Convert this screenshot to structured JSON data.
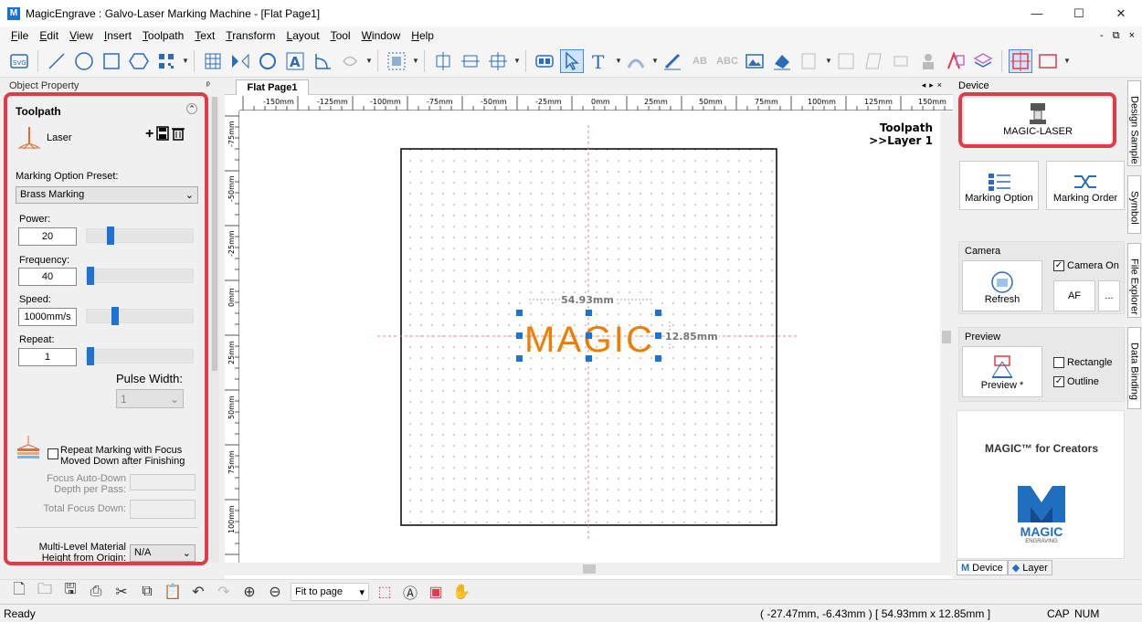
{
  "window": {
    "title": "MagicEngrave : Galvo-Laser Marking Machine - [Flat  Page1]",
    "logo": "M",
    "minimize": "—",
    "maximize": "☐",
    "close": "✕"
  },
  "menu": [
    "File",
    "Edit",
    "View",
    "Insert",
    "Toolpath",
    "Text",
    "Transform",
    "Layout",
    "Tool",
    "Window",
    "Help"
  ],
  "mdi": {
    "min": "-",
    "restore": "⧉",
    "close": "×"
  },
  "toolbar_icons": [
    "svg-icon",
    "line-icon",
    "circle-icon",
    "rect-icon",
    "polygon-icon",
    "qrcode-icon",
    "grid-icon",
    "mirror-icon",
    "rotate-icon",
    "text-a-icon",
    "arc-icon",
    "shape-icon",
    "array-icon",
    "align-left-icon",
    "align-center-icon",
    "align-middle-icon",
    "group-icon",
    "pointer-icon",
    "text-icon",
    "path-icon",
    "pen-icon",
    "ab-icon",
    "abc-icon",
    "image-icon",
    "eraser-icon",
    "fill-icon",
    "cut-icon",
    "frame-icon",
    "stamp-icon",
    "person-icon",
    "vector-icon",
    "layers-icon",
    "crosshair-icon",
    "window-icon"
  ],
  "left": {
    "panel_title": "Object Property",
    "pin": "ᵖ",
    "section": "Toolpath",
    "collapse": "⌃",
    "toolpath_name": "Laser",
    "add": "+",
    "save": "🖫",
    "delete": "🗑",
    "preset_label": "Marking Option Preset:",
    "preset_value": "Brass Marking",
    "power_label": "Power:",
    "power": "20",
    "power_frac": 0.2,
    "frequency_label": "Frequency:",
    "frequency": "40",
    "frequency_frac": 0.0,
    "speed_label": "Speed:",
    "speed": "1000mm/s",
    "speed_frac": 0.25,
    "repeat_label": "Repeat:",
    "repeat": "1",
    "repeat_frac": 0.0,
    "pulse_label": "Pulse Width:",
    "pulse_value": "1",
    "repeat_focus_label": "Repeat Marking with Focus Moved Down after Finishing",
    "focus_depth_label": "Focus Auto-Down Depth per Pass:",
    "total_focus_label": "Total Focus Down:",
    "multilevel_label": "Multi-Level Material Height from Origin:",
    "multilevel_value": "N/A"
  },
  "doc": {
    "tab": "Flat  Page1",
    "toolpath_label": "Toolpath",
    "layer_label": ">>Layer 1",
    "object_text": "MAGIC",
    "object_color": "#f07d00",
    "width_dim": "54.93mm",
    "height_dim": "12.85mm",
    "hruler": [
      "-150mm",
      "-125mm",
      "-100mm",
      "-75mm",
      "-50mm",
      "-25mm",
      "0mm",
      "25mm",
      "50mm",
      "75mm",
      "100mm",
      "125mm",
      "150mm"
    ],
    "vruler": [
      "-75mm",
      "-50mm",
      "-25mm",
      "0mm",
      "25mm",
      "50mm",
      "75mm",
      "100mm"
    ]
  },
  "right": {
    "device_title": "Device",
    "device_name": "MAGIC-LASER",
    "marking_option": "Marking Option",
    "marking_order": "Marking Order",
    "camera_title": "Camera",
    "camera_on": "Camera On",
    "refresh": "Refresh",
    "af": "AF",
    "more": "...",
    "preview_title": "Preview",
    "preview_btn": "Preview *",
    "rectangle": "Rectangle",
    "outline": "Outline",
    "promo_title": "MAGIC™ for Creators",
    "promo_logo": "MAGIC",
    "promo_sub": "ENGRAVING",
    "tab_device": "Device",
    "tab_layer": "Layer"
  },
  "sidetabs": [
    "Design Sample",
    "Symbol",
    "File Explorer",
    "Data Binding"
  ],
  "bottom": {
    "zoom": "Fit to page"
  },
  "status": {
    "ready": "Ready",
    "coords": "( -27.47mm, -6.43mm )  [ 54.93mm x 12.85mm ]",
    "cap": "CAP",
    "num": "NUM"
  }
}
